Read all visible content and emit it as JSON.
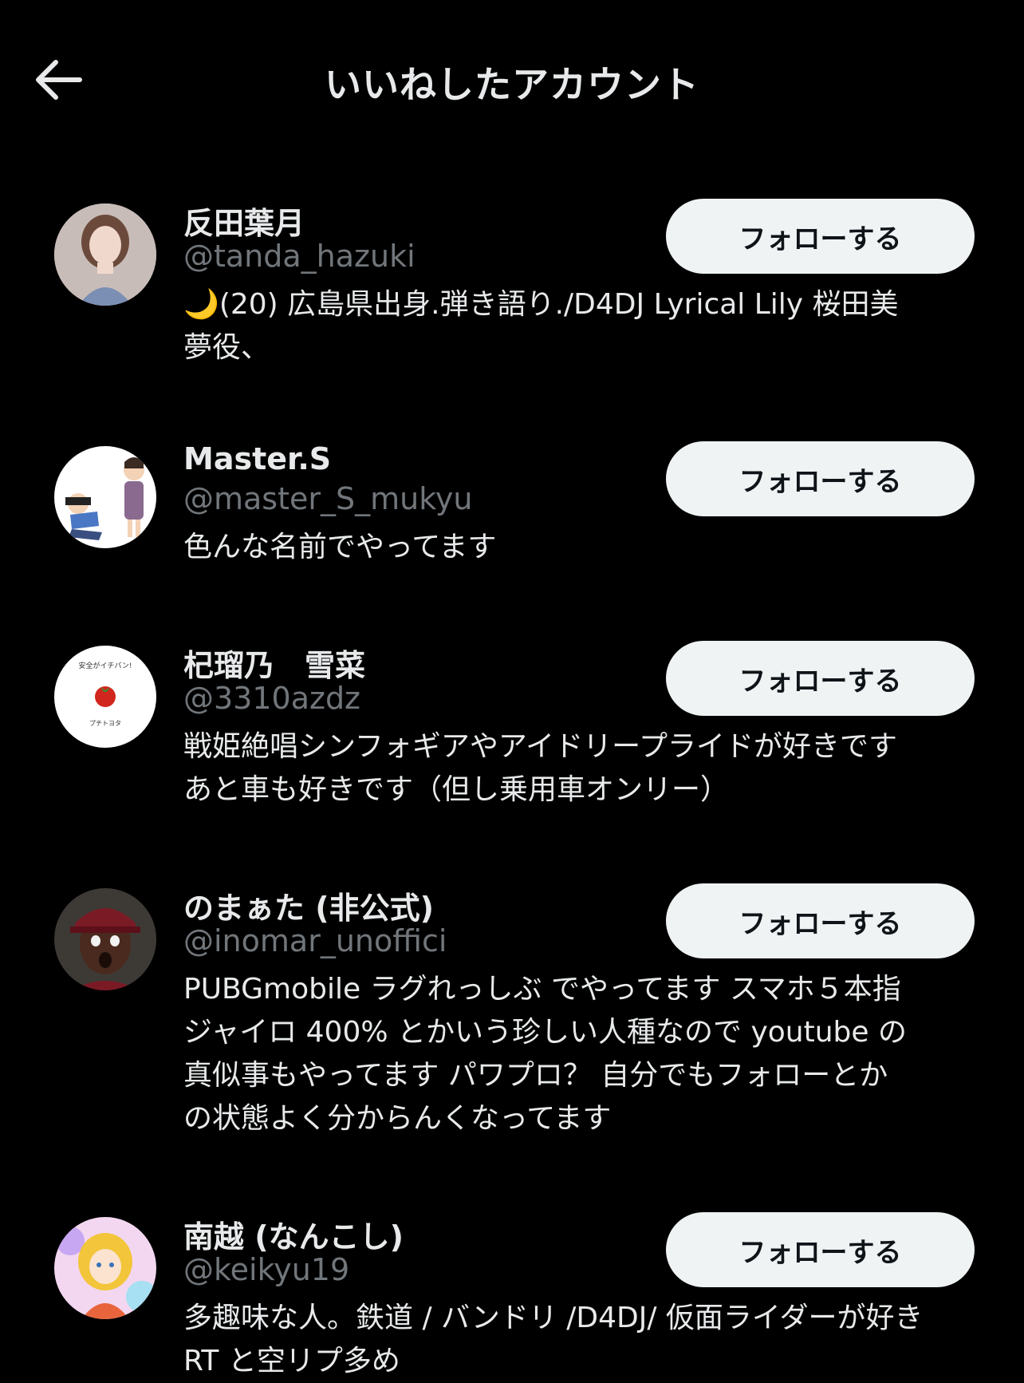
{
  "header": {
    "title": "いいねしたアカウント",
    "back_icon": "arrow-left-icon"
  },
  "users": [
    {
      "name": "反田葉月",
      "handle": "@tanda_hazuki",
      "bio_lines": [
        "🌙(20) 広島県出身.弾き語り./D4DJ Lyrical Lily 桜田美",
        "夢役、"
      ],
      "follow_label": "フォローする"
    },
    {
      "name": "Master.S",
      "handle": "@master_S_mukyu",
      "bio_lines": [
        "色んな名前でやってます"
      ],
      "follow_label": "フォローする"
    },
    {
      "name": "杞瑠乃　雪菜",
      "handle": "@3310azdz",
      "bio_lines": [
        "戦姫絶唱シンフォギアやアイドリープライドが好きです",
        "あと車も好きです（但し乗用車オンリー）"
      ],
      "follow_label": "フォローする"
    },
    {
      "name": "のまぁた (非公式)",
      "handle": "@inomar_unoffici",
      "bio_lines": [
        "PUBGmobile ラグれっしぶ でやってます スマホ５本指",
        "ジャイロ 400% とかいう珍しい人種なので youtube の",
        "真似事もやってます パワプロ？ 自分でもフォローとか",
        "の状態よく分からんくなってます"
      ],
      "follow_label": "フォローする"
    },
    {
      "name": "南越 (なんこし)",
      "handle": "@keikyu19",
      "bio_lines": [
        "多趣味な人。鉄道 / バンドリ /D4DJ/ 仮面ライダーが好き",
        "RT と空リプ多め"
      ],
      "follow_label": "フォローする"
    }
  ],
  "avatars": {
    "u0": {
      "img": "avatar-photo-woman",
      "text": ""
    },
    "u1": {
      "img": "avatar-illustration-people",
      "text": ""
    },
    "u2": {
      "img": "avatar-tomato-logo",
      "top_text": "安全がイチバン!",
      "bottom_text": "プチトヨタ"
    },
    "u3": {
      "img": "avatar-photo-baseball-player",
      "text": ""
    },
    "u4": {
      "img": "avatar-anime-character",
      "text": ""
    }
  },
  "colors": {
    "background": "#000000",
    "primary_text": "#e7e9ea",
    "secondary_text": "#71767b",
    "button_bg": "#eff3f4",
    "button_text": "#0f1419"
  }
}
